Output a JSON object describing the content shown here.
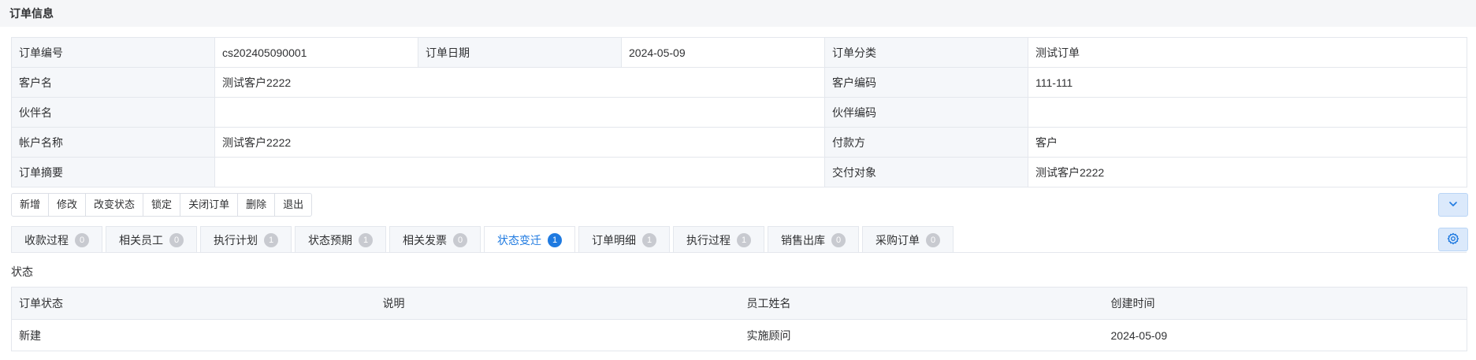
{
  "header": {
    "title": "订单信息"
  },
  "info": {
    "order_no_label": "订单编号",
    "order_no": "cs202405090001",
    "order_date_label": "订单日期",
    "order_date": "2024-05-09",
    "order_type_label": "订单分类",
    "order_type": "测试订单",
    "customer_name_label": "客户名",
    "customer_name": "测试客户2222",
    "customer_code_label": "客户编码",
    "customer_code": "111-111",
    "partner_name_label": "伙伴名",
    "partner_name": "",
    "partner_code_label": "伙伴编码",
    "partner_code": "",
    "account_name_label": "帐户名称",
    "account_name": "测试客户2222",
    "payer_label": "付款方",
    "payer": "客户",
    "summary_label": "订单摘要",
    "summary": "",
    "delivery_target_label": "交付对象",
    "delivery_target": "测试客户2222"
  },
  "toolbar": {
    "buttons": [
      "新增",
      "修改",
      "改变状态",
      "锁定",
      "关闭订单",
      "删除",
      "退出"
    ]
  },
  "icons": {
    "expand": "chevron-down-icon",
    "settings": "gear-icon"
  },
  "tabs": [
    {
      "label": "收款过程",
      "count": "0"
    },
    {
      "label": "相关员工",
      "count": "0"
    },
    {
      "label": "执行计划",
      "count": "1"
    },
    {
      "label": "状态预期",
      "count": "1"
    },
    {
      "label": "相关发票",
      "count": "0"
    },
    {
      "label": "状态变迁",
      "count": "1"
    },
    {
      "label": "订单明细",
      "count": "1"
    },
    {
      "label": "执行过程",
      "count": "1"
    },
    {
      "label": "销售出库",
      "count": "0"
    },
    {
      "label": "采购订单",
      "count": "0"
    }
  ],
  "active_tab": "状态变迁",
  "status_section": {
    "title": "状态",
    "columns": [
      "订单状态",
      "说明",
      "员工姓名",
      "创建时间"
    ],
    "rows": [
      {
        "status": "新建",
        "note": "",
        "employee": "实施顾问",
        "created": "2024-05-09"
      }
    ]
  },
  "colors": {
    "accent": "#1f7ae0",
    "badge_inactive": "#c8cad0",
    "label_bg": "#f5f7fa",
    "border": "#e4e7ed"
  }
}
